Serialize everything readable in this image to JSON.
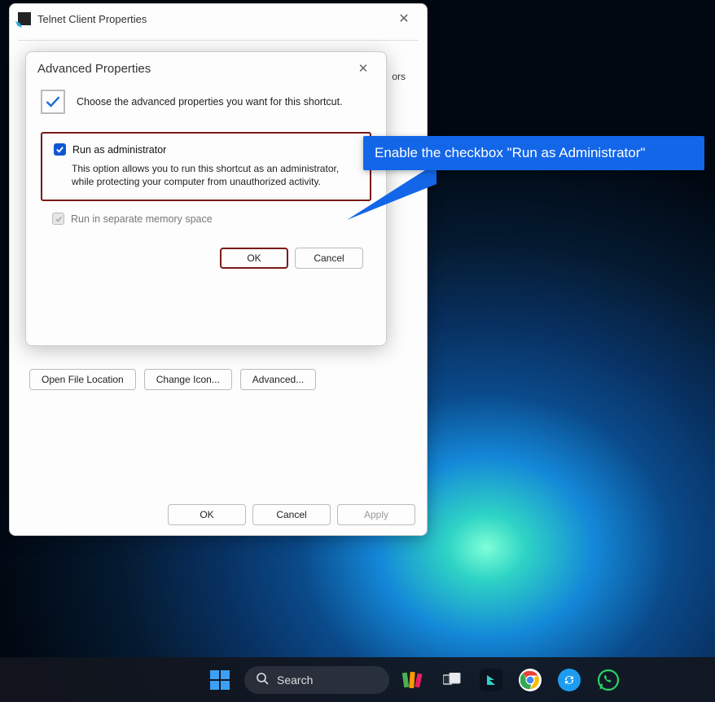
{
  "parent": {
    "title": "Telnet Client Properties",
    "tabs_visible_fragment": "ors",
    "buttons": {
      "open_location": "Open File Location",
      "change_icon": "Change Icon...",
      "advanced": "Advanced..."
    },
    "main_buttons": {
      "ok": "OK",
      "cancel": "Cancel",
      "apply": "Apply"
    }
  },
  "advanced": {
    "title": "Advanced Properties",
    "intro": "Choose the advanced properties you want for this shortcut.",
    "run_admin": {
      "checked": true,
      "label": "Run as administrator",
      "desc": "This option allows you to run this shortcut as an administrator, while protecting your computer from unauthorized activity."
    },
    "mem_space": {
      "checked": false,
      "enabled": false,
      "label": "Run in separate memory space"
    },
    "buttons": {
      "ok": "OK",
      "cancel": "Cancel"
    }
  },
  "callout": {
    "text": "Enable the checkbox \"Run as Administrator\""
  },
  "taskbar": {
    "search_placeholder": "Search"
  }
}
